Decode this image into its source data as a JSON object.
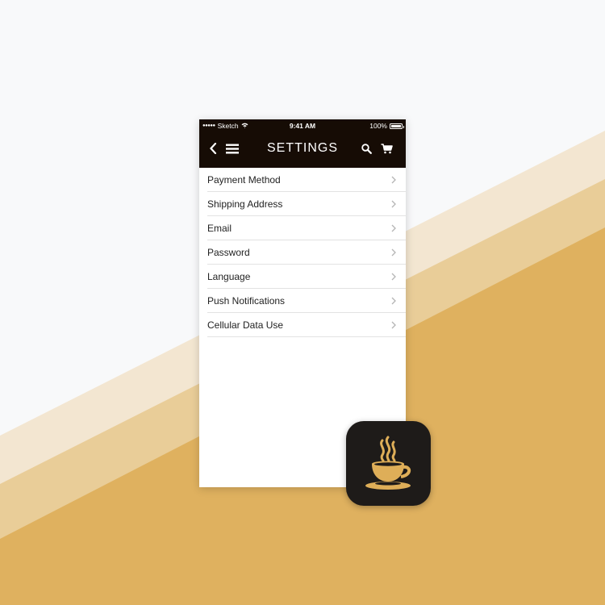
{
  "colors": {
    "background": "#f8f9fa",
    "stripe_light": "#f3e6d1",
    "stripe_mid": "#e9cd98",
    "stripe_dark": "#dfb15f",
    "bar_dark": "#160c05",
    "accent_gold": "#deae58"
  },
  "status_bar": {
    "carrier": "Sketch",
    "time": "9:41 AM",
    "battery": "100%"
  },
  "nav": {
    "title": "SETTINGS",
    "icons": [
      "back-icon",
      "menu-icon",
      "search-icon",
      "cart-icon"
    ]
  },
  "settings": {
    "items": [
      {
        "label": "Payment Method"
      },
      {
        "label": "Shipping Address"
      },
      {
        "label": "Email"
      },
      {
        "label": "Password"
      },
      {
        "label": "Language"
      },
      {
        "label": "Push Notifications"
      },
      {
        "label": "Cellular Data Use"
      }
    ]
  },
  "app_icon": {
    "icon": "coffee-cup-icon"
  }
}
